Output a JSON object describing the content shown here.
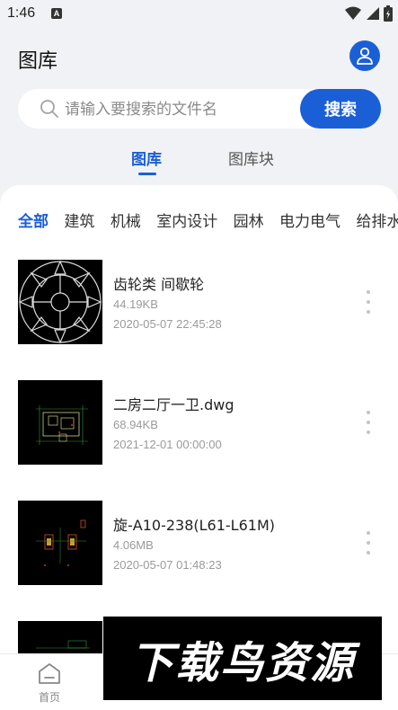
{
  "status": {
    "time": "1:46",
    "notif_letter": "A"
  },
  "header": {
    "title": "图库"
  },
  "search": {
    "placeholder": "请输入要搜索的文件名",
    "button_label": "搜索"
  },
  "tabs": [
    {
      "label": "图库",
      "active": true
    },
    {
      "label": "图库块",
      "active": false
    }
  ],
  "categories": [
    "全部",
    "建筑",
    "机械",
    "室内设计",
    "园林",
    "电力电气",
    "给排水"
  ],
  "files": [
    {
      "name": "齿轮类 间歇轮",
      "size": "44.19KB",
      "date": "2020-05-07 22:45:28"
    },
    {
      "name": "二房二厅一卫.dwg",
      "size": "68.94KB",
      "date": "2021-12-01 00:00:00"
    },
    {
      "name": "旋-A10-238(L61-L61M)",
      "size": "4.06MB",
      "date": "2020-05-07 01:48:23"
    }
  ],
  "bottom_nav": [
    {
      "label": "首页",
      "icon": "home-icon"
    }
  ],
  "watermark": {
    "text": "下载鸟资源"
  },
  "colors": {
    "accent": "#1a5fd6",
    "header_bg": "#f1f2f5"
  }
}
